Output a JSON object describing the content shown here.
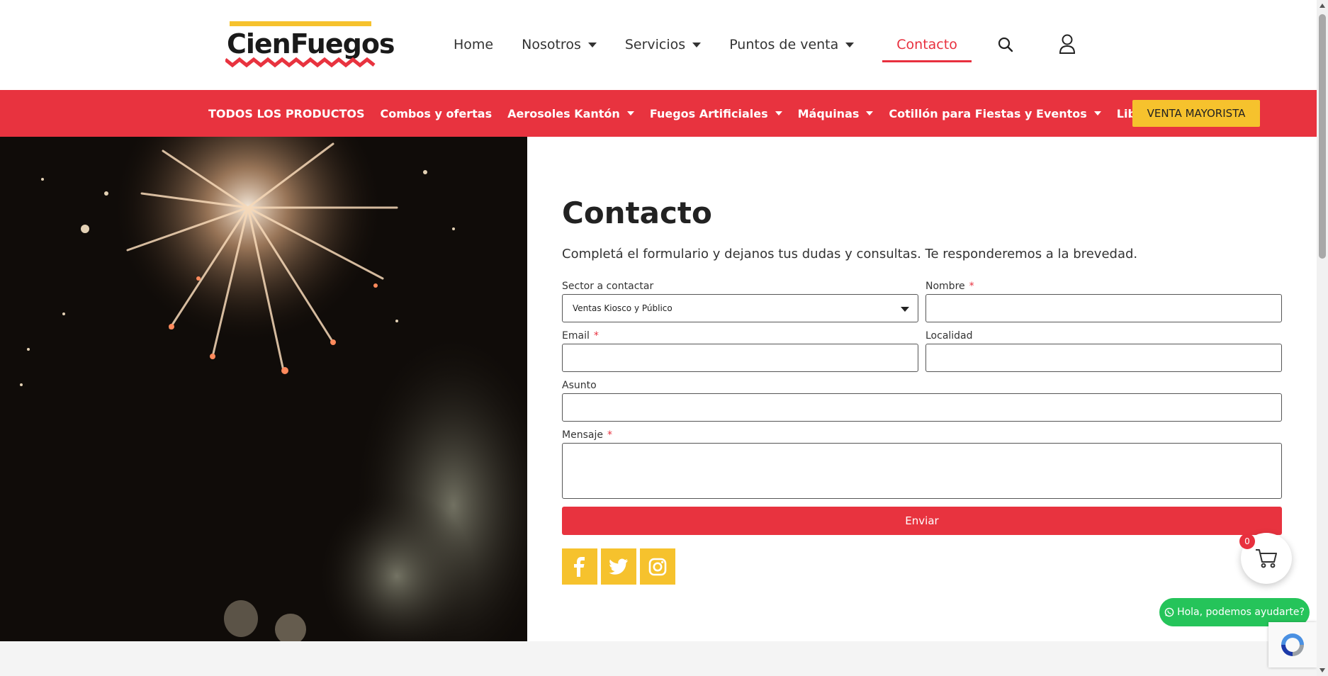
{
  "brand": {
    "name": "CienFuegos",
    "accent": "#e8333f",
    "yellow": "#f6c22d"
  },
  "header": {
    "nav": [
      {
        "label": "Home",
        "dropdown": false,
        "active": false
      },
      {
        "label": "Nosotros",
        "dropdown": true,
        "active": false
      },
      {
        "label": "Servicios",
        "dropdown": true,
        "active": false
      },
      {
        "label": "Puntos de venta",
        "dropdown": true,
        "active": false
      },
      {
        "label": "Contacto",
        "dropdown": false,
        "active": true
      }
    ],
    "icons": [
      "search-icon",
      "user-icon"
    ]
  },
  "categories": {
    "items": [
      {
        "label": "TODOS LOS PRODUCTOS",
        "dropdown": false
      },
      {
        "label": "Combos y ofertas",
        "dropdown": false
      },
      {
        "label": "Aerosoles Kantón",
        "dropdown": true
      },
      {
        "label": "Fuegos Artificiales",
        "dropdown": true
      },
      {
        "label": "Máquinas",
        "dropdown": true
      },
      {
        "label": "Cotillón para Fiestas y Eventos",
        "dropdown": true
      },
      {
        "label": "Librería",
        "dropdown": false
      }
    ],
    "cta": "VENTA MAYORISTA"
  },
  "contact": {
    "title": "Contacto",
    "intro": "Completá el formulario y dejanos tus dudas y consultas. Te responderemos a la brevedad.",
    "fields": {
      "sector_label": "Sector a contactar",
      "sector_value": "Ventas Kiosco y Público",
      "nombre_label": "Nombre",
      "email_label": "Email",
      "localidad_label": "Localidad",
      "asunto_label": "Asunto",
      "mensaje_label": "Mensaje",
      "required_mark": "*"
    },
    "submit": "Enviar",
    "social": [
      "facebook-icon",
      "twitter-icon",
      "instagram-icon"
    ]
  },
  "widgets": {
    "cart_count": "0",
    "whatsapp_label": "Hola, podemos ayudarte?"
  }
}
